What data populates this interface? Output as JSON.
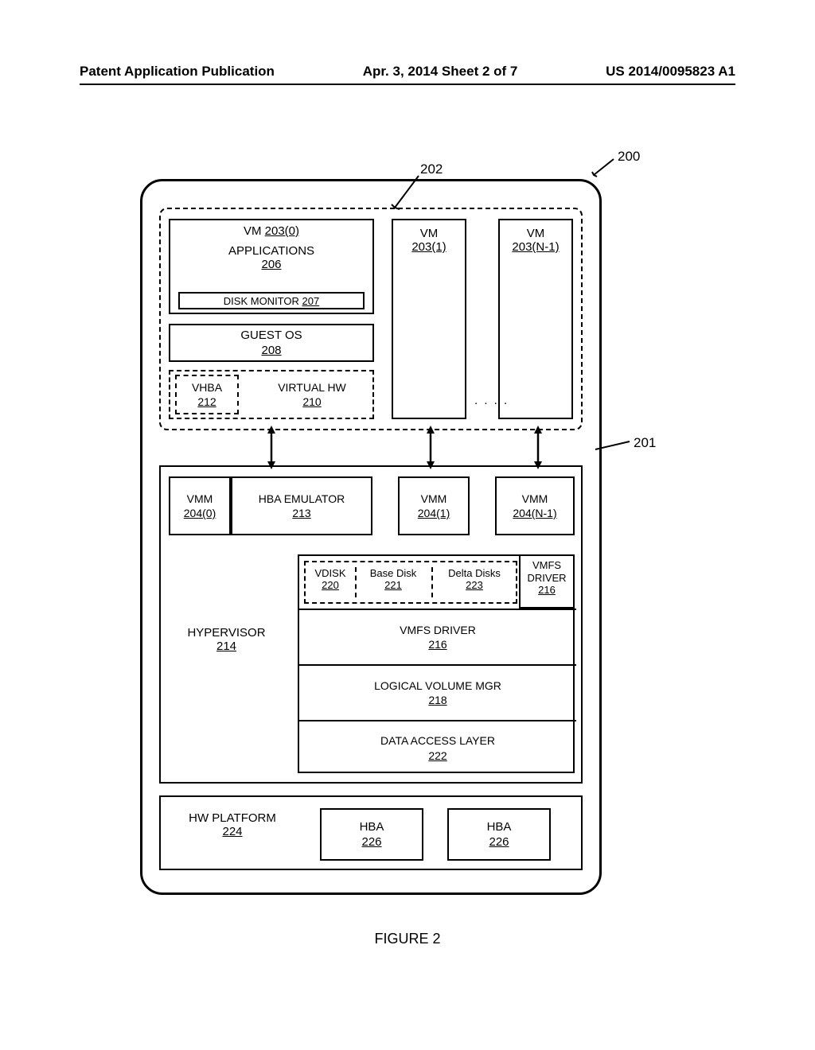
{
  "header": {
    "left": "Patent Application Publication",
    "center": "Apr. 3, 2014  Sheet 2 of 7",
    "right": "US 2014/0095823 A1"
  },
  "callouts": {
    "c200": "200",
    "c201": "201",
    "c202": "202"
  },
  "vm0": {
    "title": "VM",
    "title_ref": "203(0)",
    "apps": "APPLICATIONS",
    "apps_ref": "206",
    "dm": "DISK MONITOR",
    "dm_ref": "207",
    "guest": "GUEST OS",
    "guest_ref": "208",
    "vhba": "VHBA",
    "vhba_ref": "212",
    "vhw": "VIRTUAL HW",
    "vhw_ref": "210"
  },
  "vm1": {
    "title": "VM",
    "ref": "203(1)"
  },
  "vmN": {
    "title": "VM",
    "ref": "203(N-1)"
  },
  "ellipsis": ". . . .",
  "vmm0": {
    "title": "VMM",
    "ref": "204(0)"
  },
  "hba_emu": {
    "title": "HBA EMULATOR",
    "ref": "213"
  },
  "vmm1": {
    "title": "VMM",
    "ref": "204(1)"
  },
  "vmmN": {
    "title": "VMM",
    "ref": "204(N-1)"
  },
  "hyp": {
    "title": "HYPERVISOR",
    "ref": "214"
  },
  "vdisk": {
    "title": "VDISK",
    "ref": "220"
  },
  "basedisk": {
    "title": "Base Disk",
    "ref": "221"
  },
  "deltadisks": {
    "title": "Delta Disks",
    "ref": "223"
  },
  "vmfs_side": {
    "title": "VMFS DRIVER",
    "ref": "216"
  },
  "vmfs_row": {
    "title": "VMFS DRIVER",
    "ref": "216"
  },
  "lvm": {
    "title": "LOGICAL VOLUME MGR",
    "ref": "218"
  },
  "dal": {
    "title": "DATA ACCESS LAYER",
    "ref": "222"
  },
  "hwplat": {
    "title": "HW PLATFORM",
    "ref": "224"
  },
  "hba1": {
    "title": "HBA",
    "ref": "226"
  },
  "hba2": {
    "title": "HBA",
    "ref": "226"
  },
  "figure": "FIGURE 2"
}
